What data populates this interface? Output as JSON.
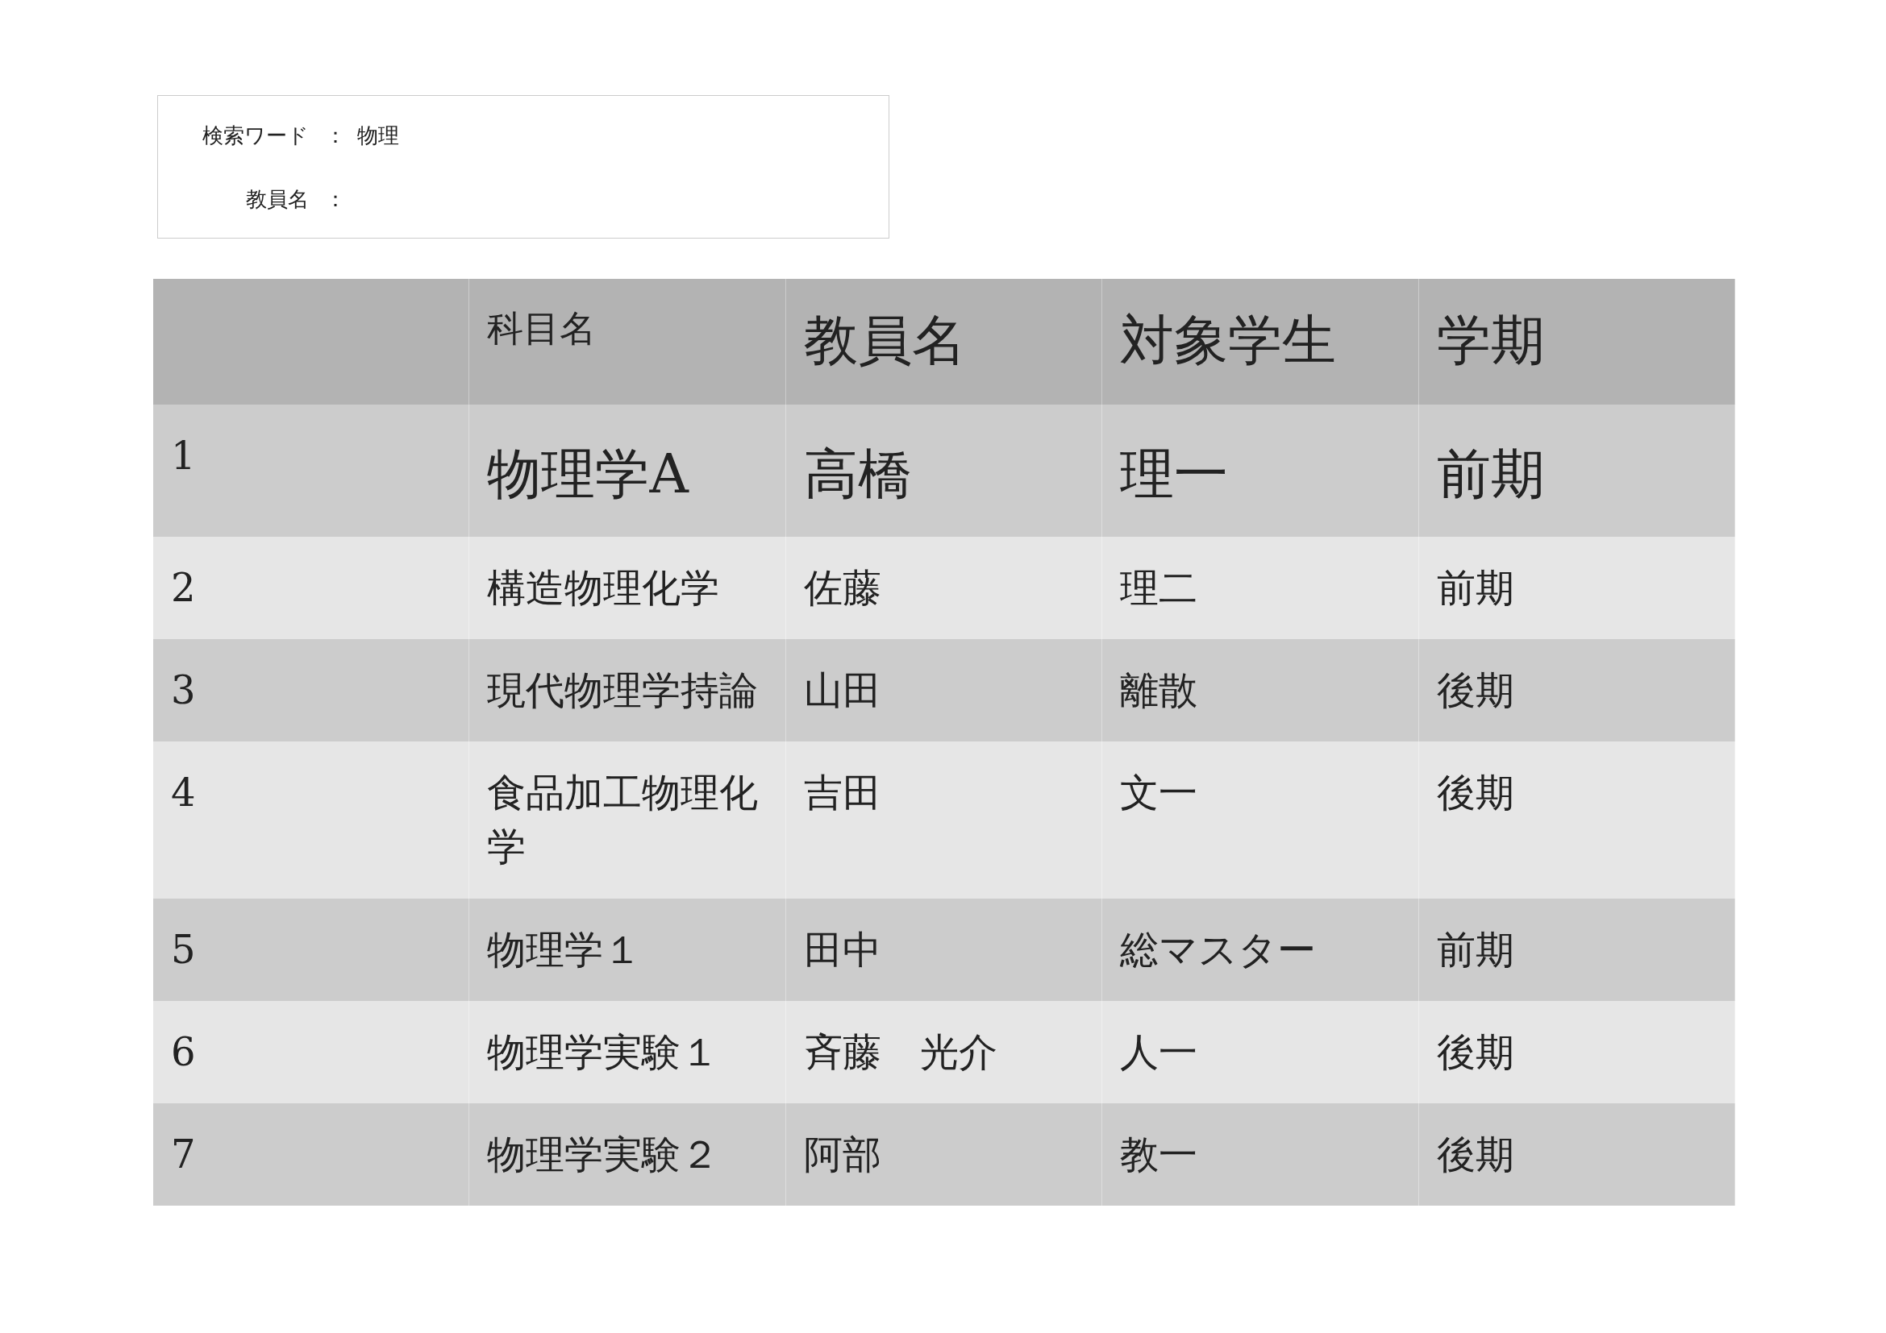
{
  "search_form": {
    "fields": [
      {
        "label": "検索ワード",
        "separator": "：",
        "value": "物理"
      },
      {
        "label": "教員名",
        "separator": "："
      }
    ]
  },
  "table": {
    "columns": [
      "科目名",
      "教員名",
      "対象学生",
      "学期"
    ],
    "rows": [
      {
        "no": "1",
        "cells": [
          "物理学A",
          "高橋",
          "理一",
          "前期"
        ]
      },
      {
        "no": "2",
        "cells": [
          "構造物理化学",
          "佐藤",
          "理二",
          "前期"
        ]
      },
      {
        "no": "3",
        "cells": [
          "現代物理学持論",
          "山田",
          "離散",
          "後期"
        ]
      },
      {
        "no": "4",
        "cells": [
          "食品加工物理化学",
          "吉田",
          "文一",
          "後期"
        ]
      },
      {
        "no": "5",
        "cells": [
          "物理学１",
          "田中",
          "総マスター",
          "前期"
        ]
      },
      {
        "no": "6",
        "cells": [
          "物理学実験１",
          "斉藤　光介",
          "人一",
          "後期"
        ]
      },
      {
        "no": "7",
        "cells": [
          "物理学実験２",
          "阿部",
          "教一",
          "後期"
        ]
      }
    ]
  }
}
